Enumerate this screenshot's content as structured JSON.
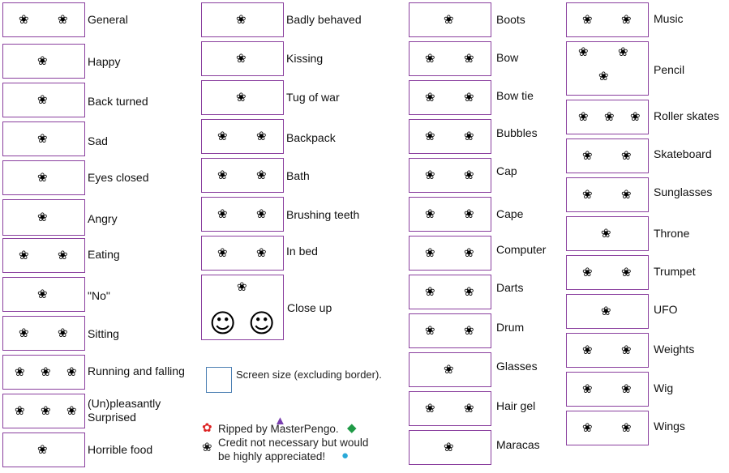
{
  "glyph": "❀",
  "glyph_big": "☺",
  "colors": {
    "frame": "#8a3f9e",
    "legend_box": "#4b7fb3"
  },
  "sprites": [
    {
      "label": "General"
    },
    {
      "label": "Happy"
    },
    {
      "label": "Back turned"
    },
    {
      "label": "Sad"
    },
    {
      "label": "Eyes closed"
    },
    {
      "label": "Angry"
    },
    {
      "label": "Eating"
    },
    {
      "label": "\"No\""
    },
    {
      "label": "Sitting"
    },
    {
      "label": "Running and falling"
    },
    {
      "label": "(Un)pleasantly Surprised"
    },
    {
      "label": "Horrible food"
    },
    {
      "label": "Badly behaved"
    },
    {
      "label": "Kissing"
    },
    {
      "label": "Tug of war"
    },
    {
      "label": "Backpack"
    },
    {
      "label": "Bath"
    },
    {
      "label": "Brushing teeth"
    },
    {
      "label": "In bed"
    },
    {
      "label": "Close up"
    },
    {
      "label": "Boots"
    },
    {
      "label": "Bow"
    },
    {
      "label": "Bow tie"
    },
    {
      "label": "Bubbles"
    },
    {
      "label": "Cap"
    },
    {
      "label": "Cape"
    },
    {
      "label": "Computer"
    },
    {
      "label": "Darts"
    },
    {
      "label": "Drum"
    },
    {
      "label": "Glasses"
    },
    {
      "label": "Hair gel"
    },
    {
      "label": "Maracas"
    },
    {
      "label": "Music"
    },
    {
      "label": "Pencil"
    },
    {
      "label": "Roller skates"
    },
    {
      "label": "Skateboard"
    },
    {
      "label": "Sunglasses"
    },
    {
      "label": "Throne"
    },
    {
      "label": "Trumpet"
    },
    {
      "label": "UFO"
    },
    {
      "label": "Weights"
    },
    {
      "label": "Wig"
    },
    {
      "label": "Wings"
    }
  ],
  "legend": {
    "text": "Screen size (excluding border)."
  },
  "credits": {
    "line1": "Ripped by MasterPengo.",
    "line2": "Credit not necessary but would",
    "line3": "be highly appreciated!"
  }
}
